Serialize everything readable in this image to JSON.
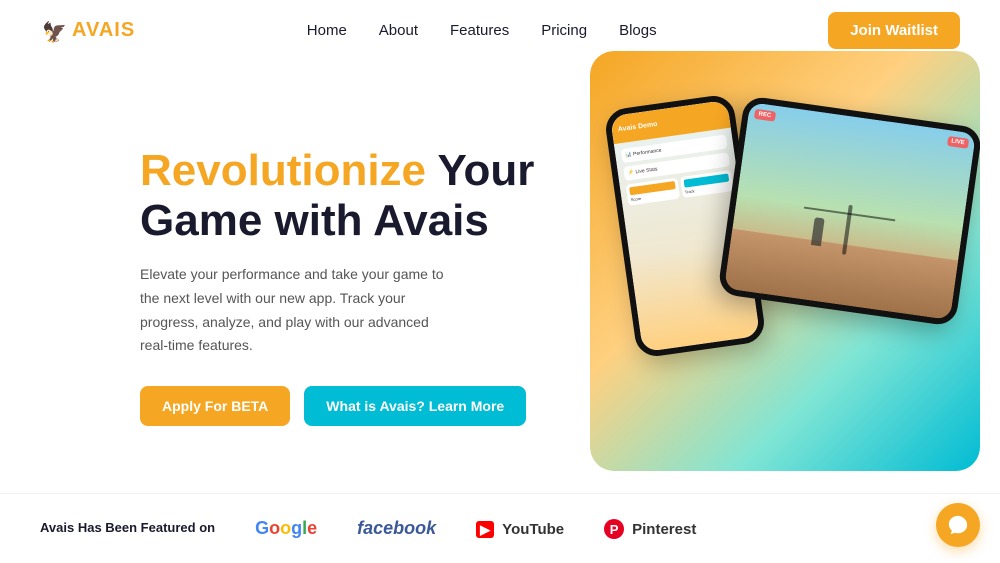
{
  "nav": {
    "logo_text": "AVAIS",
    "links": [
      {
        "label": "Home",
        "id": "home"
      },
      {
        "label": "About",
        "id": "about"
      },
      {
        "label": "Features",
        "id": "features"
      },
      {
        "label": "Pricing",
        "id": "pricing"
      },
      {
        "label": "Blogs",
        "id": "blogs"
      }
    ],
    "cta_label": "Join Waitlist"
  },
  "hero": {
    "title_highlight": "Revolutionize",
    "title_rest": " Your Game with Avais",
    "subtitle": "Elevate your performance and take your game to the next level with our new app. Track your progress, analyze, and play with our advanced real-time features.",
    "btn_beta": "Apply For BETA",
    "btn_learn": "What is Avais? Learn More"
  },
  "bottom": {
    "featured_text": "Avais Has Been Featured on",
    "brands": [
      {
        "label": "Google",
        "id": "google"
      },
      {
        "label": "facebook",
        "id": "facebook"
      },
      {
        "label": "▶ YouTube",
        "id": "youtube"
      },
      {
        "label": "⊕ Pinterest",
        "id": "pinterest"
      }
    ]
  },
  "chat": {
    "icon": "chat-icon"
  },
  "colors": {
    "accent_orange": "#F5A623",
    "accent_teal": "#00BCD4",
    "dark": "#1a1a2e"
  }
}
